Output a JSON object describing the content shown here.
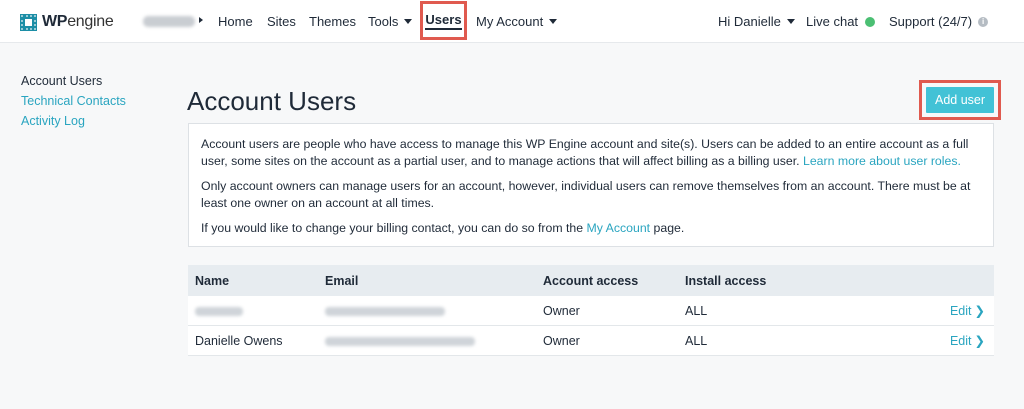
{
  "brand": {
    "logo_wp": "WP",
    "logo_engine": "engine"
  },
  "topnav": {
    "items": [
      {
        "label": "Home"
      },
      {
        "label": "Sites"
      },
      {
        "label": "Themes"
      },
      {
        "label": "Tools"
      },
      {
        "label": "Users"
      },
      {
        "label": "My Account"
      }
    ],
    "greeting": "Hi Danielle",
    "live_chat": "Live chat",
    "support": "Support (24/7)",
    "support_icon": "i"
  },
  "sidebar": {
    "items": [
      {
        "label": "Account Users"
      },
      {
        "label": "Technical Contacts"
      },
      {
        "label": "Activity Log"
      }
    ]
  },
  "page": {
    "title": "Account Users",
    "add_user_label": "Add user"
  },
  "info": {
    "p1_text": "Account users are people who have access to manage this WP Engine account and site(s). Users can be added to an entire account as a full user, some sites on the account as a partial user, and to manage actions that will affect billing as a billing user.",
    "p1_link": "Learn more about user roles.",
    "p2_text": "Only account owners can manage users for an account, however, individual users can remove themselves from an account. There must be at least one owner on an account at all times.",
    "p3_before": "If you would like to change your billing contact, you can do so from the",
    "p3_link": "My Account",
    "p3_after": "page."
  },
  "table": {
    "headers": {
      "name": "Name",
      "email": "Email",
      "access": "Account access",
      "install": "Install access"
    },
    "rows": [
      {
        "name": "",
        "email": "",
        "access": "Owner",
        "install": "ALL",
        "edit": "Edit",
        "chevron": "❯"
      },
      {
        "name": "Danielle Owens",
        "email": "",
        "access": "Owner",
        "install": "ALL",
        "edit": "Edit",
        "chevron": "❯"
      }
    ]
  },
  "colors": {
    "accent": "#42c2d6",
    "link": "#2aa5c0",
    "highlight": "#e05a4f",
    "online": "#4bbf73"
  }
}
